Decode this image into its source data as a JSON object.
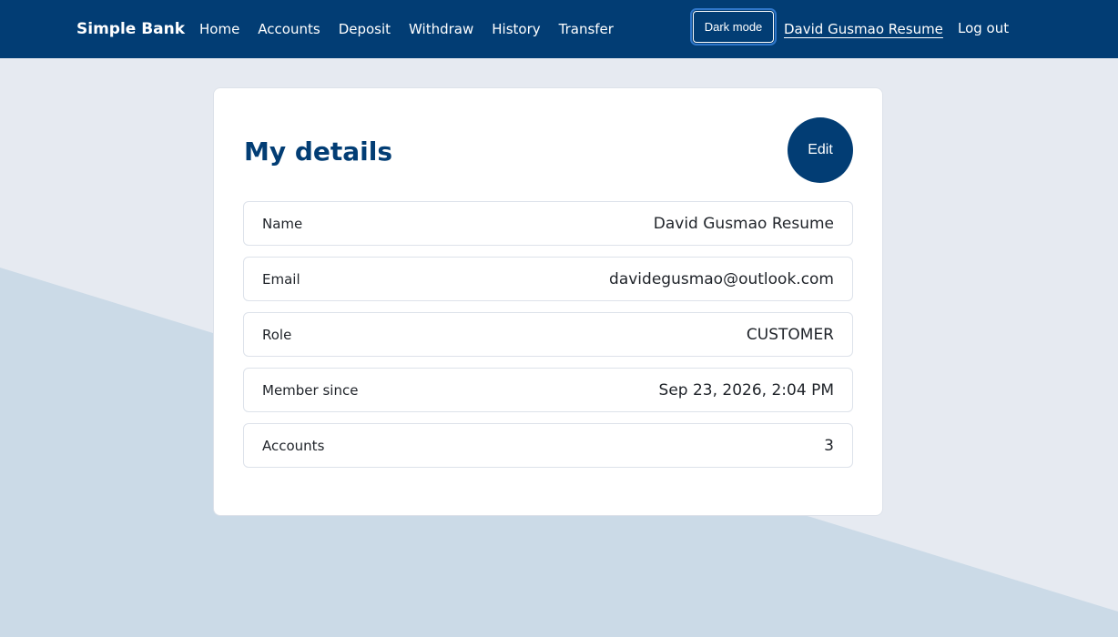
{
  "nav": {
    "brand": "Simple Bank",
    "links": [
      "Home",
      "Accounts",
      "Deposit",
      "Withdraw",
      "History",
      "Transfer"
    ],
    "dark_mode_label": "Dark mode",
    "user_name": "David Gusmao Resume",
    "logout_label": "Log out"
  },
  "details": {
    "title": "My details",
    "edit_label": "Edit",
    "rows": [
      {
        "label": "Name",
        "value": "David Gusmao Resume"
      },
      {
        "label": "Email",
        "value": "davidegusmao@outlook.com"
      },
      {
        "label": "Role",
        "value": "CUSTOMER"
      },
      {
        "label": "Member since",
        "value": "Sep 23, 2026, 2:04 PM"
      },
      {
        "label": "Accounts",
        "value": "3"
      }
    ]
  },
  "colors": {
    "primary": "#023d74",
    "background": "#e6eaf1",
    "background_accent": "#cbdae7",
    "card": "#ffffff",
    "border": "#dde2ea"
  }
}
